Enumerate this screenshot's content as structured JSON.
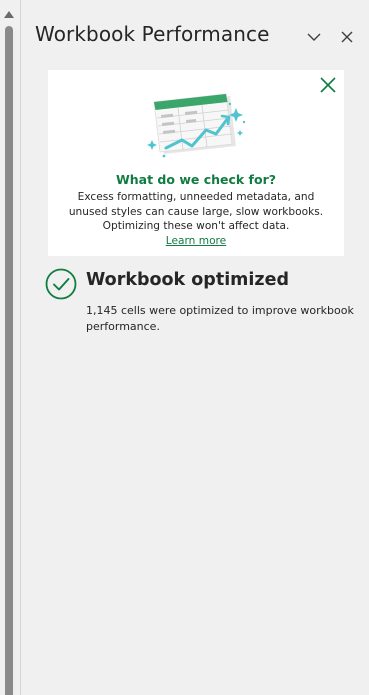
{
  "pane": {
    "title": "Workbook Performance"
  },
  "info_card": {
    "title": "What do we check for?",
    "body": "Excess formatting, unneeded metadata, and unused styles can cause large, slow workbooks. Optimizing these won't affect data.",
    "link_label": "Learn more"
  },
  "result": {
    "title": "Workbook optimized",
    "description": "1,145 cells were optimized to improve workbook performance."
  },
  "icons": {
    "scroll_up": "scroll-up-arrow-icon",
    "collapse": "chevron-down-icon",
    "close": "close-icon",
    "card_close": "close-icon",
    "result": "checkmark-circle-icon",
    "illustration": "spreadsheet-trend-illustration"
  },
  "colors": {
    "accent": "#107c41",
    "background": "#f0f0f0",
    "card": "#ffffff",
    "text": "#262626"
  }
}
